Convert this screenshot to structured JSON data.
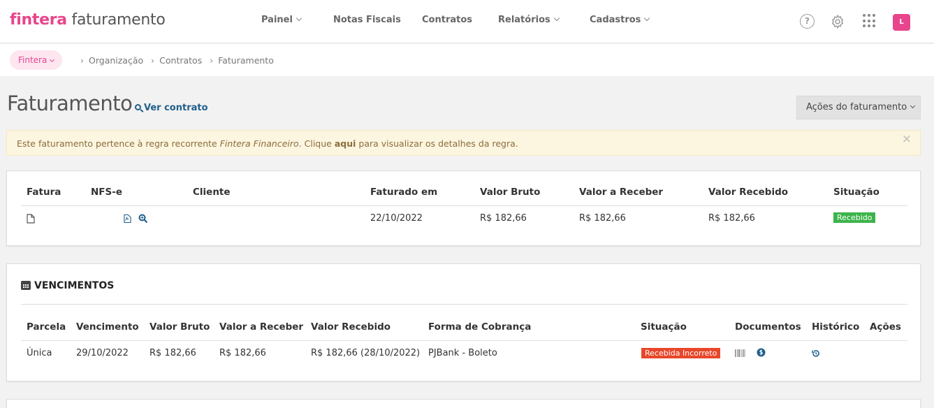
{
  "app": {
    "brand": "fintera",
    "product": "faturamento"
  },
  "nav": {
    "items": [
      {
        "label": "Painel",
        "has_dropdown": true
      },
      {
        "label": "Notas Fiscais",
        "has_dropdown": false
      },
      {
        "label": "Contratos",
        "has_dropdown": false
      },
      {
        "label": "Relatórios",
        "has_dropdown": true
      },
      {
        "label": "Cadastros",
        "has_dropdown": true
      }
    ],
    "avatar_initial": "L",
    "help_glyph": "?"
  },
  "breadcrumb": {
    "org": "Fintera",
    "items": [
      "Organização",
      "Contratos",
      "Faturamento"
    ]
  },
  "page": {
    "title": "Faturamento",
    "ver_contrato": "Ver contrato",
    "acoes_button": "Ações do faturamento"
  },
  "alert": {
    "text_before": "Este faturamento pertence à regra recorrente ",
    "rule_name": "Fintera Financeiro",
    "text_middle": ". Clique ",
    "link": "aqui",
    "text_after": " para visualizar os detalhes da regra.",
    "close": "×"
  },
  "invoice_table": {
    "headers": [
      "Fatura",
      "NFS-e",
      "Cliente",
      "Faturado em",
      "Valor Bruto",
      "Valor a Receber",
      "Valor Recebido",
      "Situação"
    ],
    "row": {
      "cliente": "",
      "faturado_em": "22/10/2022",
      "valor_bruto": "R$ 182,66",
      "valor_a_receber": "R$ 182,66",
      "valor_recebido": "R$ 182,66",
      "situacao": "Recebido"
    }
  },
  "vencimentos": {
    "title": "VENCIMENTOS",
    "headers": [
      "Parcela",
      "Vencimento",
      "Valor Bruto",
      "Valor a Receber",
      "Valor Recebido",
      "Forma de Cobrança",
      "Situação",
      "Documentos",
      "Histórico",
      "Ações"
    ],
    "row": {
      "parcela": "Única",
      "vencimento": "29/10/2022",
      "valor_bruto": "R$ 182,66",
      "valor_a_receber": "R$ 182,66",
      "valor_recebido": "R$ 182,66 (28/10/2022)",
      "forma_cobranca": "PJBank - Boleto",
      "situacao": "Recebida Incorreto"
    }
  },
  "colors": {
    "brand_pink": "#e8458c",
    "link_blue": "#1f5f8b",
    "status_green": "#3cb44b",
    "status_red": "#e8472b"
  }
}
